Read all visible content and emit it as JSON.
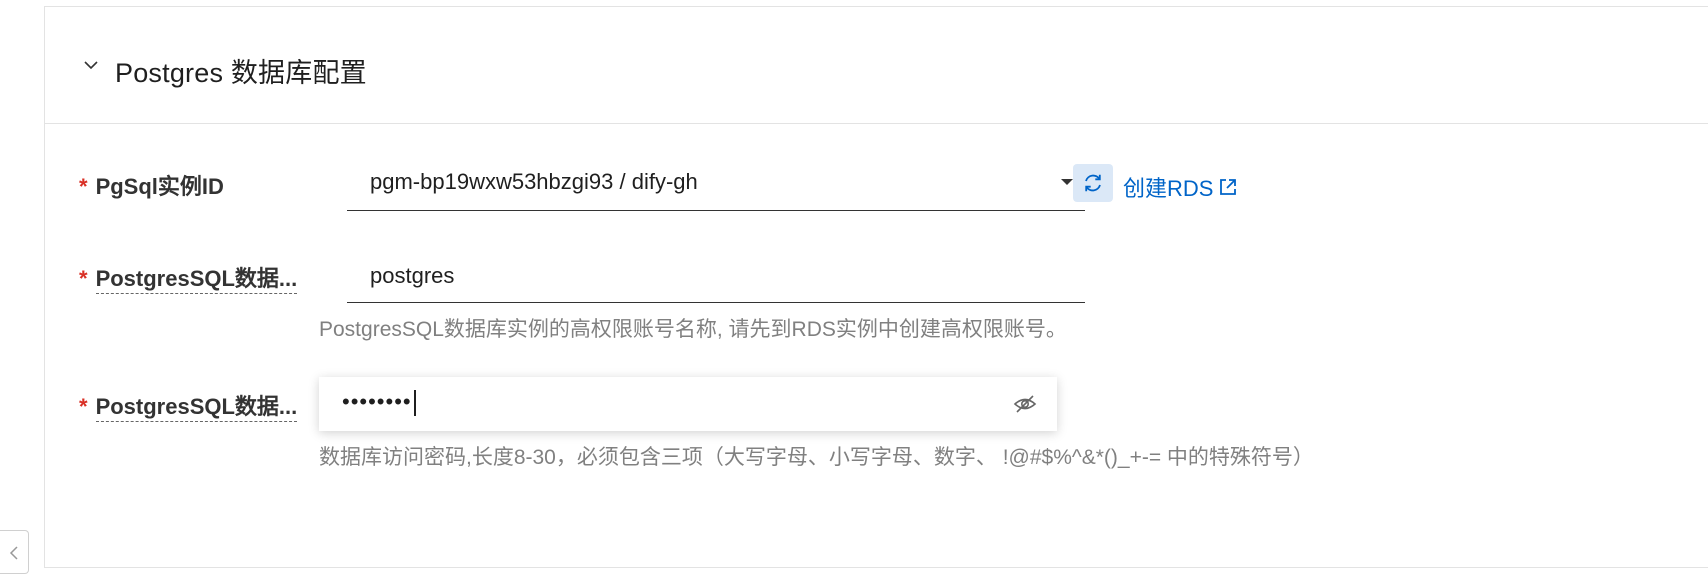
{
  "section": {
    "title": "Postgres 数据库配置",
    "collapse_icon": "chevron-down-icon"
  },
  "fields": {
    "instance_id": {
      "label": "PgSql实例ID",
      "value": "pgm-bp19wxw53hbzgi93 / dify-gh",
      "dropdown_icon": "caret-down-icon"
    },
    "refresh": {
      "icon": "refresh-icon"
    },
    "create_link": {
      "label": "创建RDS",
      "icon": "external-link-icon",
      "color": "#0064c8"
    },
    "db_user": {
      "label": "PostgresSQL数据...",
      "value": "postgres",
      "help": "PostgresSQL数据库实例的高权限账号名称, 请先到RDS实例中创建高权限账号。"
    },
    "db_password": {
      "label": "PostgresSQL数据...",
      "value": "••••••••",
      "help": "数据库访问密码,长度8-30，必须包含三项（大写字母、小写字母、数字、 !@#$%^&*()_+-= 中的特殊符号）",
      "visibility_icon": "eye-off-icon"
    }
  },
  "required_marker": "*",
  "colors": {
    "accent": "#0064c8",
    "required": "#d93026",
    "help_text": "#808080"
  }
}
